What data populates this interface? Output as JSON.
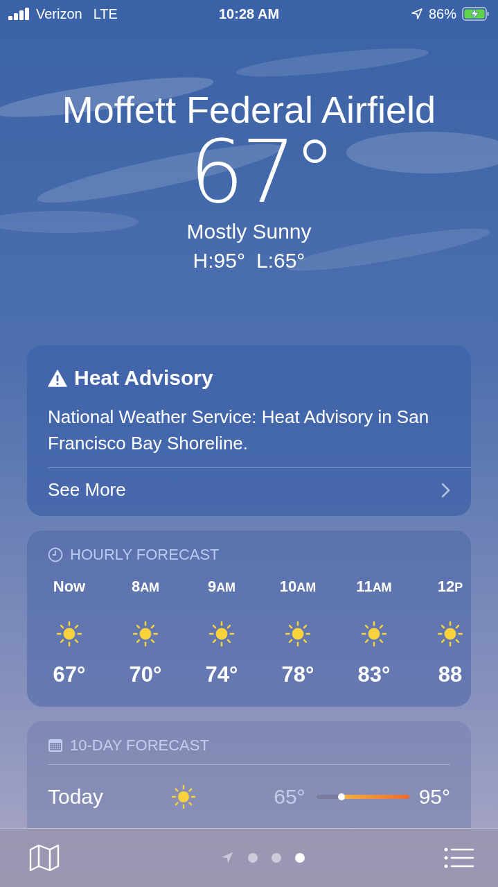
{
  "status_bar": {
    "carrier": "Verizon",
    "network": "LTE",
    "time": "10:28 AM",
    "battery": "86%",
    "charging": true
  },
  "location": {
    "name": "Moffett Federal Airfield",
    "temperature": "67°",
    "condition": "Mostly Sunny",
    "high": "H:95°",
    "low": "L:65°"
  },
  "alert": {
    "title": "Heat Advisory",
    "text": "National Weather Service: Heat Advisory in San Francisco Bay Shoreline.",
    "link": "See More"
  },
  "hourly": {
    "title": "HOURLY FORECAST",
    "hours": [
      {
        "time": "Now",
        "temp": "67°",
        "kind": "sun"
      },
      {
        "time": "8",
        "period": "AM",
        "temp": "70°",
        "kind": "sun"
      },
      {
        "time": "9",
        "period": "AM",
        "temp": "74°",
        "kind": "sun"
      },
      {
        "time": "10",
        "period": "AM",
        "temp": "78°",
        "kind": "sun"
      },
      {
        "time": "11",
        "period": "AM",
        "temp": "83°",
        "kind": "sun"
      },
      {
        "time": "12",
        "period": "P",
        "temp": "88",
        "kind": "sun"
      }
    ]
  },
  "daily": {
    "title": "10-DAY FORECAST",
    "days": [
      {
        "day": "Today",
        "kind": "sun",
        "low": "65°",
        "high": "95°",
        "range": {
          "level": 0.73
        },
        "now": {
          "level": 0.27
        }
      }
    ]
  },
  "pages": [
    {
      "kind": "location",
      "selected": false
    },
    {
      "kind": "dot",
      "selected": false
    },
    {
      "kind": "dot",
      "selected": false
    },
    {
      "kind": "dot",
      "selected": true
    }
  ]
}
